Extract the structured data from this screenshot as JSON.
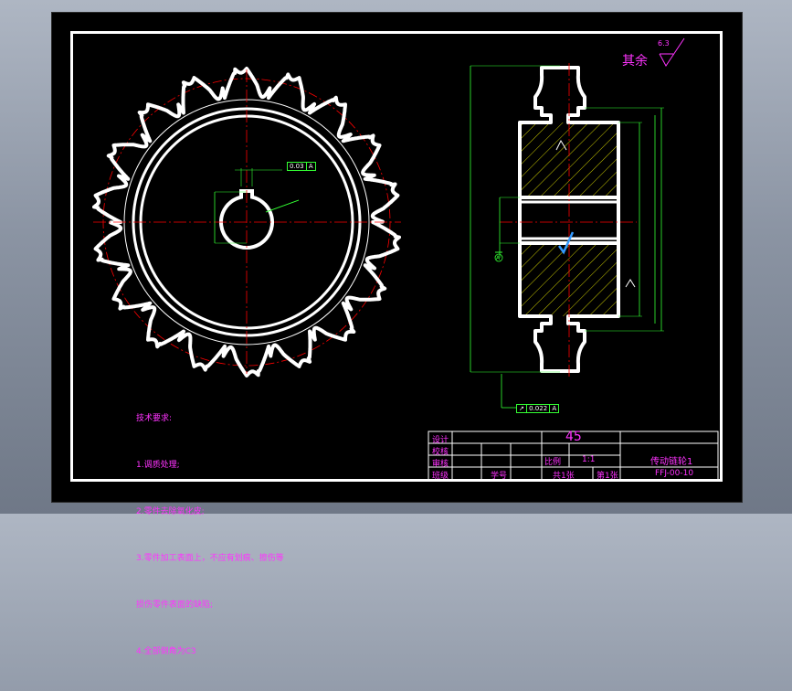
{
  "drawing": {
    "finish_label": "其余",
    "finish_value": "6.3",
    "tech_requirements": {
      "title": "技术要求:",
      "items": [
        "1.调质处理;",
        "2.零件去除氧化皮;",
        "3.零件加工表面上，不应有划痕、擦伤等",
        "损伤零件表面的缺陷;",
        "4.全部倒角为C3"
      ]
    },
    "front_view": {
      "tolerance_value": "0.03",
      "tolerance_datum": "A"
    },
    "section_view": {
      "tolerance_value": "0.022",
      "tolerance_datum": "A",
      "datum_label": "A"
    },
    "title_block": {
      "material": "45",
      "row_labels": [
        "设计",
        "校核",
        "审核",
        "班级"
      ],
      "student_no_label": "学号",
      "scale_label": "比例",
      "scale_value": "1:1",
      "sheets_total": "共1张",
      "sheet_current": "第1张",
      "part_name": "传动链轮1",
      "drawing_no": "FFJ-00-10"
    }
  },
  "colors": {
    "paper": "#000000",
    "outline": "#ffffff",
    "centerline": "#ff0000",
    "dimension": "#33ff33",
    "annotation": "#ff33ff",
    "hatch": "#ffff00"
  }
}
